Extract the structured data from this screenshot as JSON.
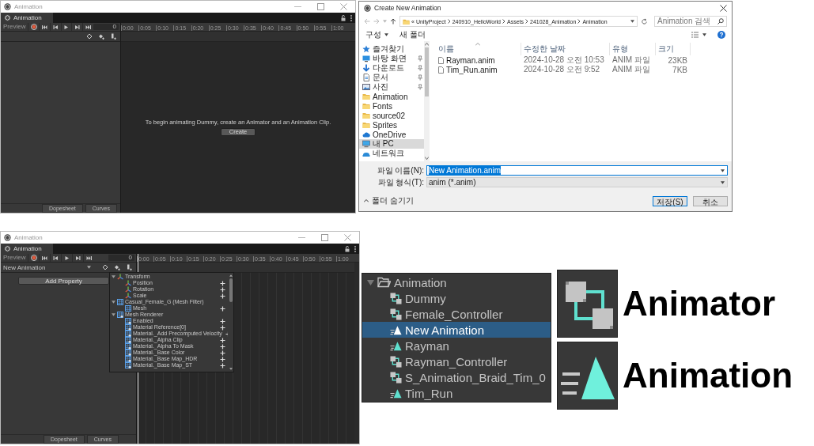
{
  "animation_windows": [
    {
      "title": "Animation",
      "tab": "Animation",
      "preview": "Preview",
      "frame": "0",
      "timeline_ticks": [
        "0:00",
        "0:05",
        "0:10",
        "0:15",
        "0:20",
        "0:25",
        "0:30",
        "0:35",
        "0:40",
        "0:45",
        "0:50",
        "0:55",
        "1:00"
      ],
      "message": "To begin animating Dummy, create an Animator and an Animation Clip.",
      "create_button": "Create",
      "view_tabs": [
        "Dopesheet",
        "Curves"
      ]
    },
    {
      "title": "Animation",
      "tab": "Animation",
      "preview": "Preview",
      "frame": "0",
      "clip": "New Animation",
      "timeline_ticks": [
        "0:00",
        "0:05",
        "0:10",
        "0:15",
        "0:20",
        "0:25",
        "0:30",
        "0:35",
        "0:40",
        "0:45",
        "0:50",
        "0:55",
        "1:00"
      ],
      "add_property": "Add Property",
      "properties": [
        {
          "kind": "transform",
          "label": "Transform",
          "expanded": true,
          "children": [
            {
              "kind": "transform",
              "label": "Position"
            },
            {
              "kind": "transform",
              "label": "Rotation"
            },
            {
              "kind": "transform",
              "label": "Scale"
            }
          ]
        },
        {
          "kind": "mesh",
          "label": "Casual_Female_G (Mesh Filter)",
          "expanded": true,
          "children": [
            {
              "kind": "mesh",
              "label": "Mesh"
            }
          ]
        },
        {
          "kind": "renderer",
          "label": "Mesh Renderer",
          "expanded": true,
          "children": [
            {
              "kind": "renderer",
              "label": "Enabled"
            },
            {
              "kind": "renderer",
              "label": "Material Reference[0]"
            },
            {
              "kind": "renderer",
              "label": "Material._Add Precomputed Velocity"
            },
            {
              "kind": "renderer",
              "label": "Material._Alpha Clip"
            },
            {
              "kind": "renderer",
              "label": "Material._Alpha To Mask"
            },
            {
              "kind": "renderer",
              "label": "Material._Base Color"
            },
            {
              "kind": "renderer",
              "label": "Material._Base Map_HDR"
            },
            {
              "kind": "renderer",
              "label": "Material._Base Map_ST"
            }
          ]
        }
      ],
      "view_tabs": [
        "Dopesheet",
        "Curves"
      ]
    }
  ],
  "file_dialog": {
    "title": "Create New Animation",
    "path": [
      "«",
      "UnityProject",
      "240910_HelloWorld",
      "Assets",
      "241028_Animation",
      "Animation"
    ],
    "search_placeholder": "Animation 검색",
    "toolbar": [
      "구성",
      "새 폴더"
    ],
    "sidebar": [
      {
        "kind": "star",
        "label": "즐겨찾기",
        "pinned": false,
        "selected": false
      },
      {
        "kind": "desktop",
        "label": "바탕 화면",
        "pinned": true,
        "selected": false
      },
      {
        "kind": "download",
        "label": "다운로드",
        "pinned": true,
        "selected": false
      },
      {
        "kind": "document",
        "label": "문서",
        "pinned": true,
        "selected": false
      },
      {
        "kind": "picture",
        "label": "사진",
        "pinned": true,
        "selected": false
      },
      {
        "kind": "folder",
        "label": "Animation",
        "pinned": false,
        "selected": false
      },
      {
        "kind": "folder",
        "label": "Fonts",
        "pinned": false,
        "selected": false
      },
      {
        "kind": "folder",
        "label": "source02",
        "pinned": false,
        "selected": false
      },
      {
        "kind": "folder",
        "label": "Sprites",
        "pinned": false,
        "selected": false
      },
      {
        "kind": "cloud",
        "label": "OneDrive",
        "pinned": false,
        "selected": false
      },
      {
        "kind": "pc",
        "label": "내 PC",
        "pinned": false,
        "selected": true
      },
      {
        "kind": "network",
        "label": "네트워크",
        "pinned": false,
        "selected": false
      }
    ],
    "columns": [
      "이름",
      "수정한 날짜",
      "유형",
      "크기"
    ],
    "files": [
      {
        "name": "Rayman.anim",
        "modified": "2024-10-28 오전 10:53",
        "type": "ANIM 파일",
        "size": "23KB"
      },
      {
        "name": "Tim_Run.anim",
        "modified": "2024-10-28 오전 9:52",
        "type": "ANIM 파일",
        "size": "7KB"
      }
    ],
    "filename_label": "파일 이름(N):",
    "filename": "New Animation.anim",
    "filename_selected": true,
    "filetype_label": "파일 형식(T):",
    "filetype": "anim (*.anim)",
    "hide_folders": "폴더 숨기기",
    "buttons": [
      "저장(S)",
      "취소"
    ]
  },
  "project_tree": {
    "items": [
      {
        "kind": "folder",
        "label": "Animation",
        "expanded": true,
        "selected": false,
        "children": [
          {
            "kind": "controller",
            "label": "Dummy",
            "selected": false
          },
          {
            "kind": "controller",
            "label": "Female_Controller",
            "selected": false
          },
          {
            "kind": "clip",
            "label": "New Animation",
            "selected": true
          },
          {
            "kind": "clip",
            "label": "Rayman",
            "selected": false
          },
          {
            "kind": "controller",
            "label": "Rayman_Controller",
            "selected": false
          },
          {
            "kind": "controller",
            "label": "S_Animation_Braid_Tim_0",
            "selected": false
          },
          {
            "kind": "clip",
            "label": "Tim_Run",
            "selected": false
          }
        ]
      }
    ]
  },
  "icon_legend": [
    {
      "kind": "controller",
      "label": "Animator"
    },
    {
      "kind": "clip",
      "label": "Animation"
    }
  ]
}
